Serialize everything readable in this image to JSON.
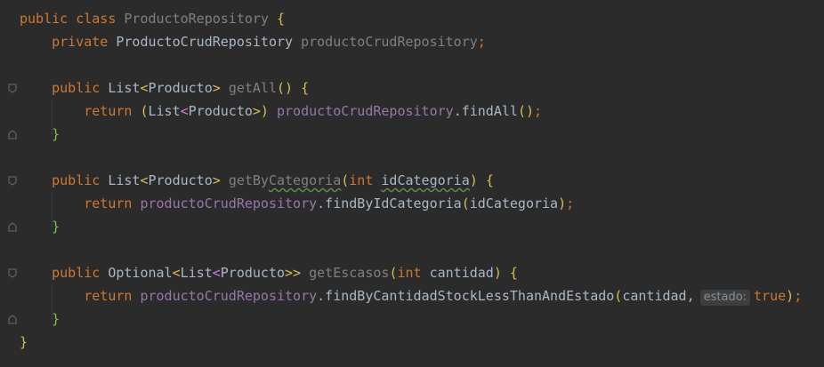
{
  "code": {
    "class_kw": "public class",
    "class_name": "ProductoRepository",
    "open_brace": "{",
    "field_mod": "private",
    "field_type": "ProductoCrudRepository",
    "field_name": "productoCrudRepository",
    "semicolon": ";",
    "m1": {
      "mod": "public",
      "ret_type": "List",
      "gen_open": "<",
      "gen_type": "Producto",
      "gen_close": ">",
      "name": "getAll",
      "parens": "()",
      "open": "{",
      "ret_kw": "return",
      "cast_open": "(",
      "cast_type": "List",
      "cast_gen_open": "<",
      "cast_gen_type": "Producto",
      "cast_gen_close": ">)",
      "target": "productoCrudRepository",
      "call": ".findAll",
      "call_parens": "()",
      "end": ";",
      "close": "}"
    },
    "m2": {
      "mod": "public",
      "ret_type": "List",
      "gen_open": "<",
      "gen_type": "Producto",
      "gen_close": ">",
      "name_a": "getBy",
      "name_b": "Categoria",
      "p_open": "(",
      "param_type": "int",
      "param_name": "idCategoria",
      "p_close": ")",
      "open": "{",
      "ret_kw": "return",
      "target": "productoCrudRepository",
      "call": ".findByIdCategoria",
      "arg_open": "(",
      "arg": "idCategoria",
      "arg_close": ")",
      "end": ";",
      "close": "}"
    },
    "m3": {
      "mod": "public",
      "ret_type": "Optional",
      "gen_open": "<",
      "inner_type": "List",
      "inner_open": "<",
      "gen_type": "Producto",
      "gen_close": ">>",
      "name": "getEscasos",
      "p_open": "(",
      "param_type": "int",
      "param_name": "cantidad",
      "p_close": ")",
      "open": "{",
      "ret_kw": "return",
      "target": "productoCrudRepository",
      "call": ".findByCantidadStockLessThanAndEstado",
      "arg_open": "(",
      "arg1": "cantidad,",
      "hint": "estado:",
      "arg2": "true",
      "arg_close": ")",
      "end": ";",
      "close": "}"
    },
    "class_close": "}"
  },
  "colors": {
    "background": "#2b2b2b",
    "keyword": "#cc7832",
    "text": "#a9b7c6",
    "field": "#9876aa",
    "unused": "#808080",
    "brace_yellow": "#d6bf55",
    "brace_green": "#7ec34e"
  }
}
